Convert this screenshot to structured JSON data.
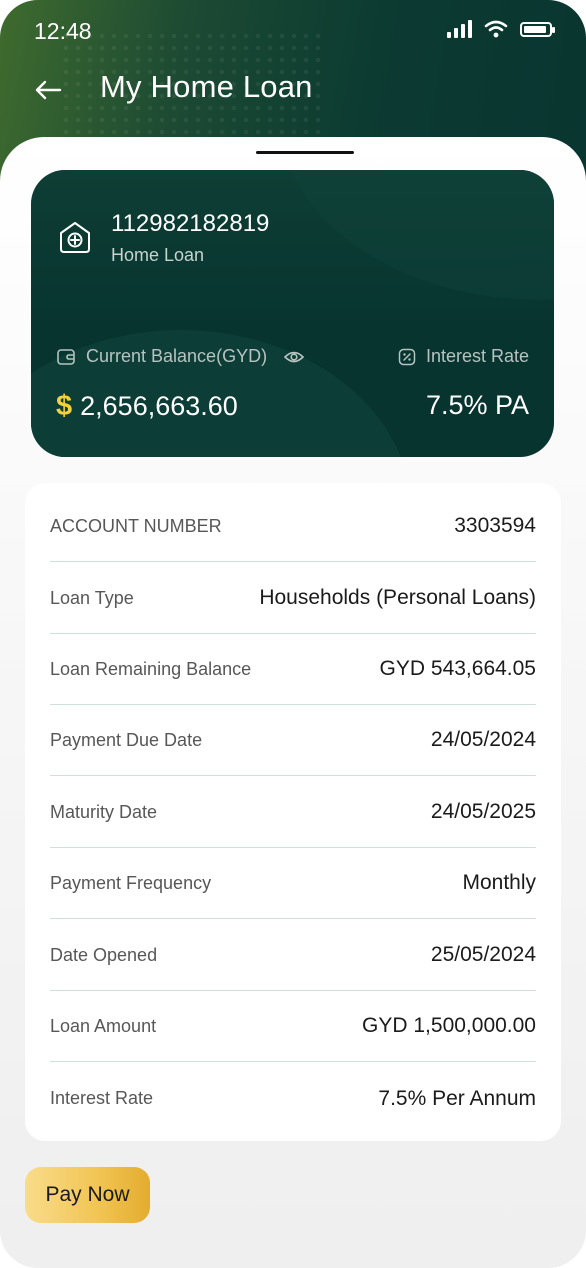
{
  "status_bar": {
    "time": "12:48"
  },
  "header": {
    "title": "My Home Loan"
  },
  "loan_card": {
    "account_number": "112982182819",
    "account_type": "Home Loan",
    "balance_label": "Current Balance(GYD)",
    "currency_symbol": "$",
    "balance_value": "2,656,663.60",
    "interest_label": "Interest Rate",
    "interest_value": "7.5% PA"
  },
  "details": {
    "rows": [
      {
        "label": "ACCOUNT NUMBER",
        "value": "3303594"
      },
      {
        "label": "Loan Type",
        "value": "Households (Personal Loans)"
      },
      {
        "label": "Loan Remaining Balance",
        "value": "GYD 543,664.05"
      },
      {
        "label": "Payment Due Date",
        "value": "24/05/2024"
      },
      {
        "label": "Maturity Date",
        "value": "24/05/2025"
      },
      {
        "label": "Payment Frequency",
        "value": "Monthly"
      },
      {
        "label": "Date Opened",
        "value": "25/05/2024"
      },
      {
        "label": "Loan Amount",
        "value": "GYD 1,500,000.00"
      },
      {
        "label": "Interest Rate",
        "value": "7.5% Per Annum"
      }
    ]
  },
  "actions": {
    "pay_now_label": "Pay Now"
  },
  "colors": {
    "header_dark_green": "#0c3b32",
    "card_green": "#07342f",
    "pay_button_gold": "#f1c452",
    "divider": "#cfe0d8"
  },
  "icons": {
    "back": "arrow-left-icon",
    "account": "home-icon",
    "wallet": "wallet-icon",
    "visibility": "eye-icon",
    "percent": "percent-icon",
    "signal": "cellular-signal-icon",
    "wifi": "wifi-icon",
    "battery": "battery-icon"
  }
}
